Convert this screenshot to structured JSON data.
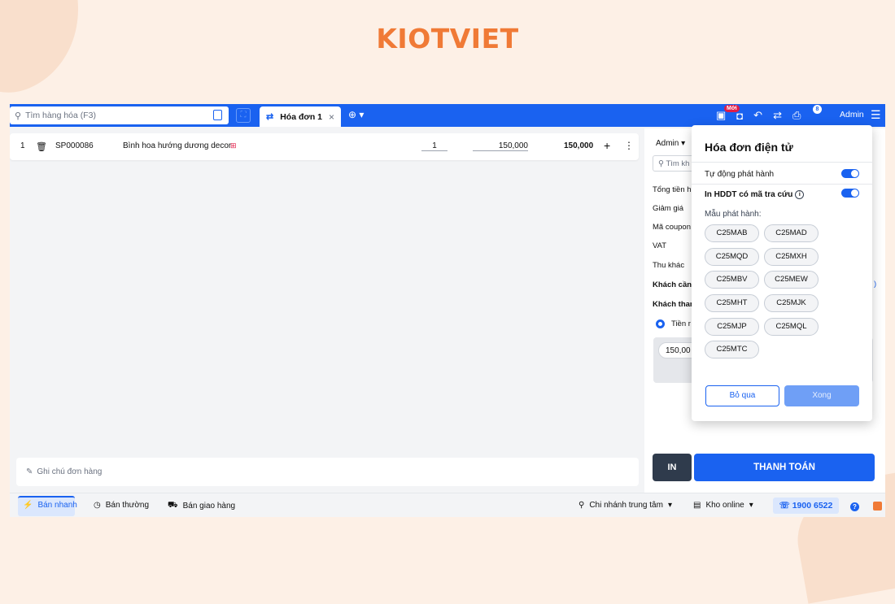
{
  "brand": {
    "logo": "KIOTVIET"
  },
  "topbar": {
    "search_placeholder": "Tìm hàng hóa (F3)",
    "tab_label": "Hóa đơn 1",
    "new_badge": "Mới",
    "notif_badge": "8",
    "user": "Admin"
  },
  "cart": {
    "items": [
      {
        "index": "1",
        "code": "SP000086",
        "name": "Bình hoa hướng dương decor",
        "qty": "1",
        "price": "150,000",
        "total": "150,000"
      }
    ],
    "note_placeholder": "Ghi chú đơn hàng"
  },
  "right_panel": {
    "seller": "Admin",
    "customer_search": "Tìm kh",
    "labels": {
      "total": "Tổng tiền h",
      "discount": "Giảm giá",
      "coupon": "Mã coupon",
      "vat": "VAT",
      "other": "Thu khác",
      "to_pay": "Khách cần",
      "paid": "Khách than"
    },
    "payment_method": "Tiền r",
    "cash_value": "150,00",
    "print_btn": "IN",
    "pay_btn": "THANH TOÁN"
  },
  "popup": {
    "title": "Hóa đơn điện tử",
    "auto_issue_label": "Tự động phát hành",
    "print_lookup_label": "In HDDT có mã tra cứu",
    "template_label": "Mẫu phát hành:",
    "templates": [
      "C25MAB",
      "C25MAD",
      "C25MQD",
      "C25MXH",
      "C25MBV",
      "C25MEW",
      "C25MHT",
      "C25MJK",
      "C25MJP",
      "C25MQL",
      "C25MTC"
    ],
    "skip_btn": "Bỏ qua",
    "done_btn": "Xong",
    "auto_issue_on": true,
    "print_lookup_on": true
  },
  "bottombar": {
    "quick_sale": "Bán nhanh",
    "normal_sale": "Bán thường",
    "delivery_sale": "Bán giao hàng",
    "branch": "Chi nhánh trung tâm",
    "warehouse": "Kho online",
    "hotline": "1900 6522"
  },
  "colors": {
    "primary": "#1a62f0",
    "brand_orange": "#f07a36",
    "background": "#fdf0e6"
  }
}
